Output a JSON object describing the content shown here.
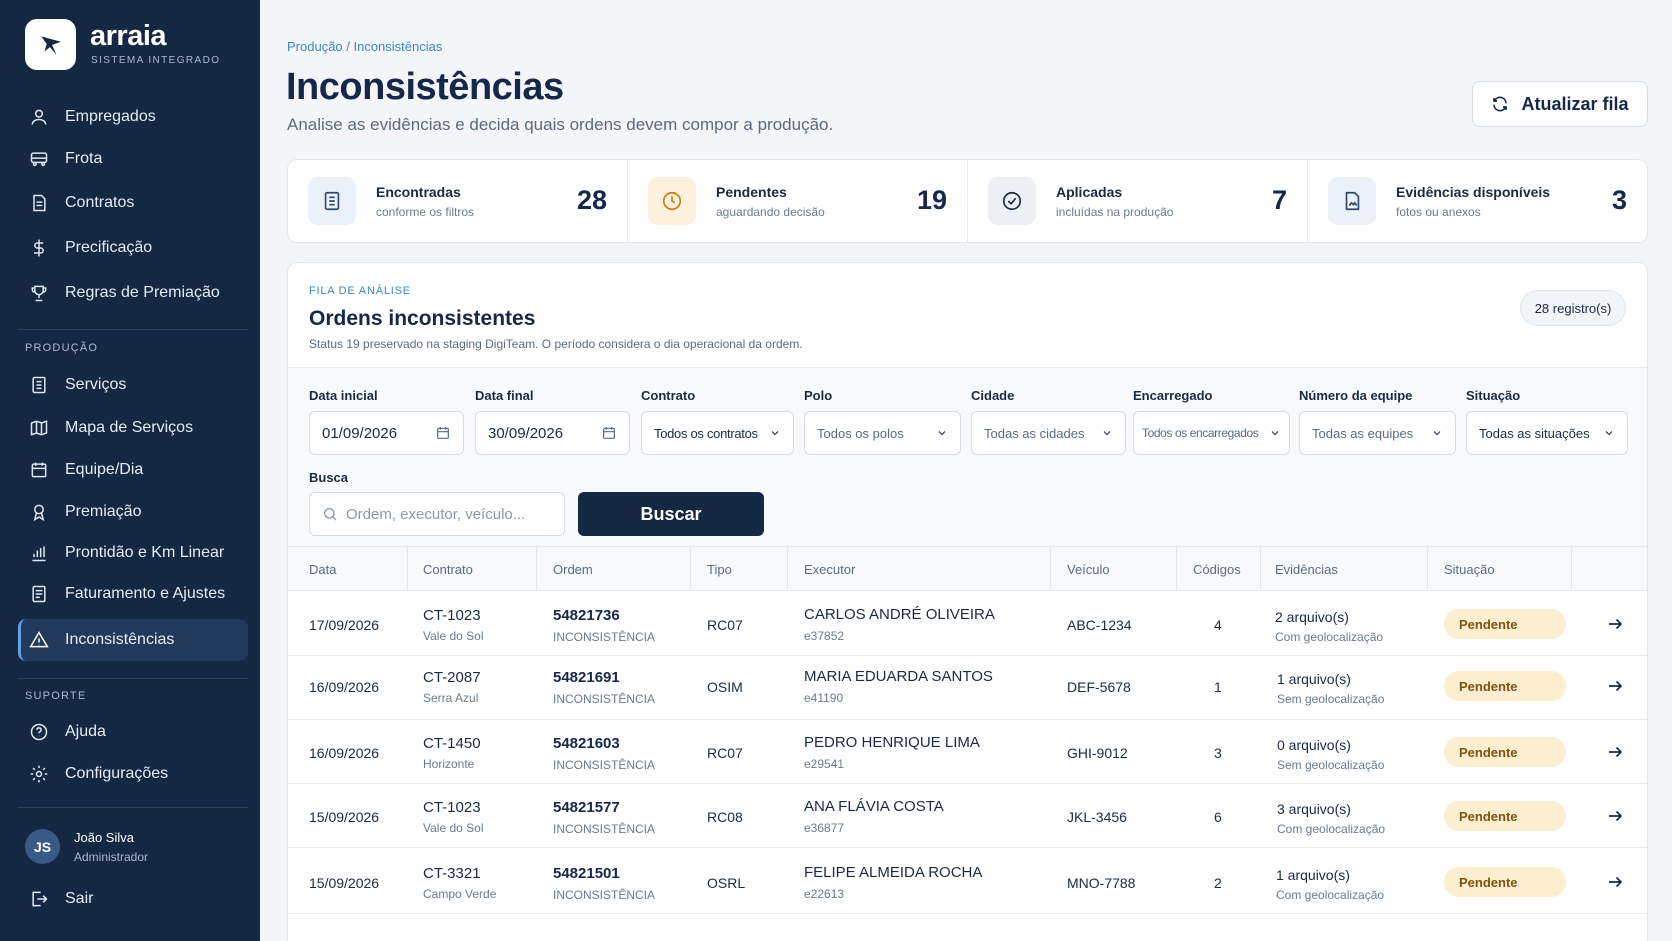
{
  "brand": {
    "name": "arraia",
    "subtitle": "SISTEMA INTEGRADO"
  },
  "sidebar": {
    "main_items": [
      {
        "label": "Empregados",
        "icon": "user-icon"
      },
      {
        "label": "Frota",
        "icon": "bus-icon"
      },
      {
        "label": "Contratos",
        "icon": "document-icon"
      },
      {
        "label": "Precificação",
        "icon": "dollar-icon"
      },
      {
        "label": "Regras de Premiação",
        "icon": "trophy-icon"
      }
    ],
    "producao_label": "PRODUÇÃO",
    "producao_items": [
      {
        "label": "Serviços",
        "icon": "list-icon"
      },
      {
        "label": "Mapa de Serviços",
        "icon": "map-icon"
      },
      {
        "label": "Equipe/Dia",
        "icon": "calendar-icon"
      },
      {
        "label": "Premiação",
        "icon": "medal-icon"
      },
      {
        "label": "Prontidão e Km Linear",
        "icon": "bar-chart-icon"
      },
      {
        "label": "Faturamento e Ajustes",
        "icon": "receipt-icon"
      },
      {
        "label": "Inconsistências",
        "icon": "warning-icon",
        "active": true
      }
    ],
    "suporte_label": "SUPORTE",
    "suporte_items": [
      {
        "label": "Ajuda",
        "icon": "help-icon"
      },
      {
        "label": "Configurações",
        "icon": "gear-icon"
      }
    ],
    "user": {
      "initials": "JS",
      "name": "João Silva",
      "role": "Administrador"
    },
    "logout_label": "Sair"
  },
  "header": {
    "breadcrumb": "Produção / Inconsistências",
    "title": "Inconsistências",
    "subtitle": "Analise as evidências e decida quais ordens devem compor a produção.",
    "refresh_label": "Atualizar fila"
  },
  "stats": [
    {
      "label": "Encontradas",
      "sub": "conforme os filtros",
      "value": "28",
      "icon": "document-icon",
      "bg": "#eaf1f8",
      "fg": "#2f4a6d"
    },
    {
      "label": "Pendentes",
      "sub": "aguardando decisão",
      "value": "19",
      "icon": "clock-icon",
      "bg": "#fdf0dc",
      "fg": "#c77d14"
    },
    {
      "label": "Aplicadas",
      "sub": "incluídas na produção",
      "value": "7",
      "icon": "check-circle-icon",
      "bg": "#eceff4",
      "fg": "#1b2a44"
    },
    {
      "label": "Evidências disponíveis",
      "sub": "fotos ou anexos",
      "value": "3",
      "icon": "file-image-icon",
      "bg": "#eaf1f8",
      "fg": "#2f4a6d"
    }
  ],
  "card": {
    "eyebrow": "FILA DE ANÁLISE",
    "title": "Ordens inconsistentes",
    "description": "Status 19 preservado na staging DigiTeam. O período considera o dia operacional da ordem.",
    "count": "28 registro(s)"
  },
  "filters": {
    "data_inicial": {
      "label": "Data inicial",
      "value": "01/09/2026"
    },
    "data_final": {
      "label": "Data final",
      "value": "30/09/2026"
    },
    "contrato": {
      "label": "Contrato",
      "value": "Todos os contratos"
    },
    "polo": {
      "label": "Polo",
      "value": "Todos os polos"
    },
    "cidade": {
      "label": "Cidade",
      "value": "Todas as cidades"
    },
    "encarregado": {
      "label": "Encarregado",
      "value": "Todos os encarregados"
    },
    "equipe": {
      "label": "Número da equipe",
      "value": "Todas as equipes"
    },
    "situacao": {
      "label": "Situação",
      "value": "Todas as situações"
    },
    "busca": {
      "label": "Busca",
      "placeholder": "Ordem, executor, veículo..."
    },
    "search_button": "Buscar"
  },
  "table": {
    "headers": [
      "Data",
      "Contrato",
      "Ordem",
      "Tipo",
      "Executor",
      "Veículo",
      "Códigos",
      "Evidências",
      "Situação"
    ],
    "rows": [
      {
        "date": "17/09/2026",
        "contract": "CT-1023",
        "contract_sub": "Vale do Sol",
        "order": "54821736",
        "order_sub": "INCONSISTÊNCIA",
        "type": "RC07",
        "executor": "CARLOS ANDRÉ OLIVEIRA",
        "executor_id": "e37852",
        "vehicle": "ABC-1234",
        "codes": "4",
        "evidence": "2 arquivo(s)",
        "evidence_sub": "Com geolocalização",
        "status": "Pendente"
      },
      {
        "date": "16/09/2026",
        "contract": "CT-2087",
        "contract_sub": "Serra Azul",
        "order": "54821691",
        "order_sub": "INCONSISTÊNCIA",
        "type": "OSIM",
        "executor": "MARIA EDUARDA SANTOS",
        "executor_id": "e41190",
        "vehicle": "DEF-5678",
        "codes": "1",
        "evidence": "1 arquivo(s)",
        "evidence_sub": "Sem geolocalização",
        "status": "Pendente"
      },
      {
        "date": "16/09/2026",
        "contract": "CT-1450",
        "contract_sub": "Horizonte",
        "order": "54821603",
        "order_sub": "INCONSISTÊNCIA",
        "type": "RC07",
        "executor": "PEDRO HENRIQUE LIMA",
        "executor_id": "e29541",
        "vehicle": "GHI-9012",
        "codes": "3",
        "evidence": "0 arquivo(s)",
        "evidence_sub": "Sem geolocalização",
        "status": "Pendente"
      },
      {
        "date": "15/09/2026",
        "contract": "CT-1023",
        "contract_sub": "Vale do Sol",
        "order": "54821577",
        "order_sub": "INCONSISTÊNCIA",
        "type": "RC08",
        "executor": "ANA FLÁVIA COSTA",
        "executor_id": "e36877",
        "vehicle": "JKL-3456",
        "codes": "6",
        "evidence": "3 arquivo(s)",
        "evidence_sub": "Com geolocalização",
        "status": "Pendente"
      },
      {
        "date": "15/09/2026",
        "contract": "CT-3321",
        "contract_sub": "Campo Verde",
        "order": "54821501",
        "order_sub": "INCONSISTÊNCIA",
        "type": "OSRL",
        "executor": "FELIPE ALMEIDA ROCHA",
        "executor_id": "e22613",
        "vehicle": "MNO-7788",
        "codes": "2",
        "evidence": "1 arquivo(s)",
        "evidence_sub": "Com geolocalização",
        "status": "Pendente"
      }
    ]
  }
}
